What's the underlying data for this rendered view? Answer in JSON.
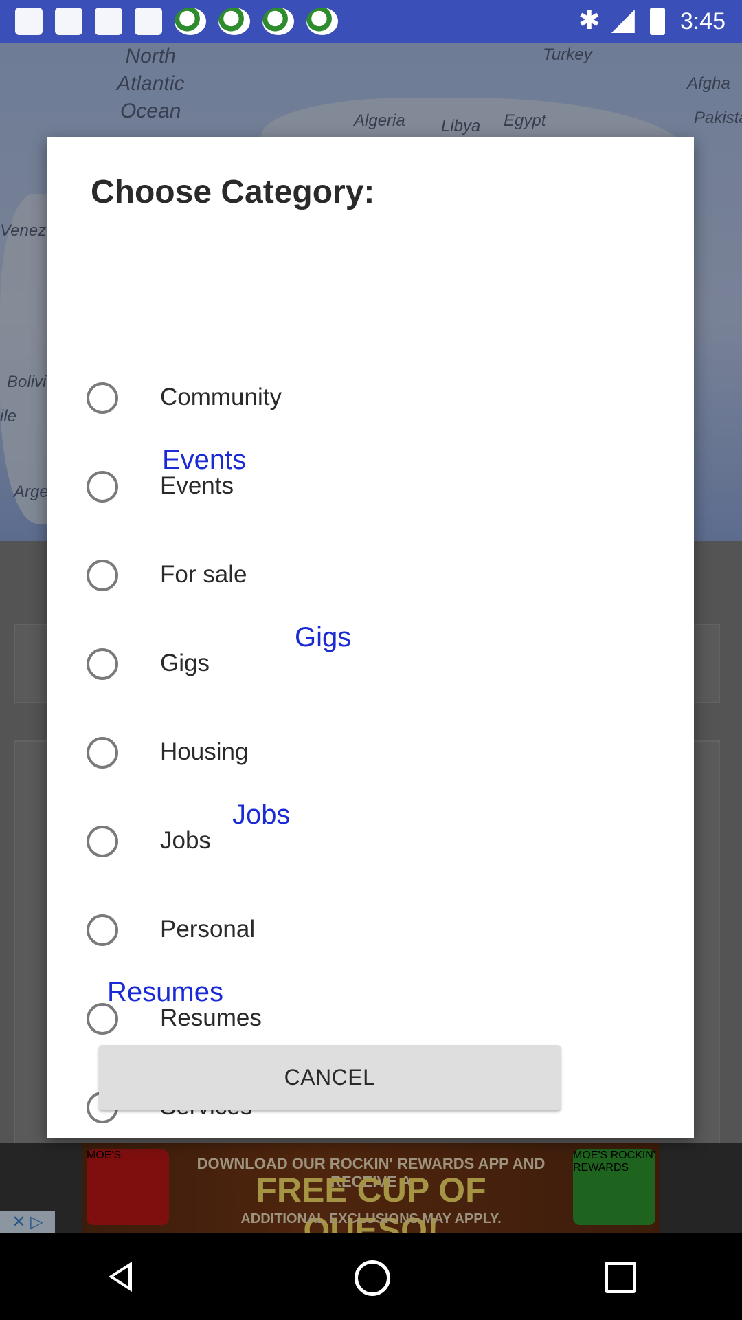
{
  "status_bar": {
    "time": "3:45"
  },
  "map": {
    "labels": [
      {
        "text": "North\nAtlantic\nOcean"
      },
      {
        "text": "Turkey"
      },
      {
        "text": "Algeria"
      },
      {
        "text": "Libya"
      },
      {
        "text": "Egypt"
      },
      {
        "text": "Afgha"
      },
      {
        "text": "Pakista"
      },
      {
        "text": "Venezu"
      },
      {
        "text": "Bolivi"
      },
      {
        "text": "ile"
      },
      {
        "text": "Arge"
      }
    ]
  },
  "dialog": {
    "title": "Choose Category:",
    "options": [
      {
        "label": "Community"
      },
      {
        "label": "Events",
        "overlay_label": "Events"
      },
      {
        "label": "For sale"
      },
      {
        "label": "Gigs",
        "overlay_label": "Gigs"
      },
      {
        "label": "Housing"
      },
      {
        "label": "Jobs",
        "overlay_label": "Jobs"
      },
      {
        "label": "Personal"
      },
      {
        "label": "Resumes",
        "overlay_label": "Resumes"
      },
      {
        "label": "Services"
      }
    ],
    "cancel_label": "CANCEL"
  },
  "ad": {
    "line1": "DOWNLOAD OUR ROCKIN' REWARDS APP AND RECEIVE A",
    "line2": "FREE CUP OF QUESO!",
    "line3": "ADDITIONAL EXCLUSIONS MAY APPLY.",
    "logo_left": "MOE'S",
    "logo_right": "MOE'S ROCKIN' REWARDS",
    "close": "✕ ▷"
  },
  "colors": {
    "status_bar": "#3b4fb8",
    "accent_blue": "#1a2bd6",
    "dialog_bg": "#ffffff"
  }
}
